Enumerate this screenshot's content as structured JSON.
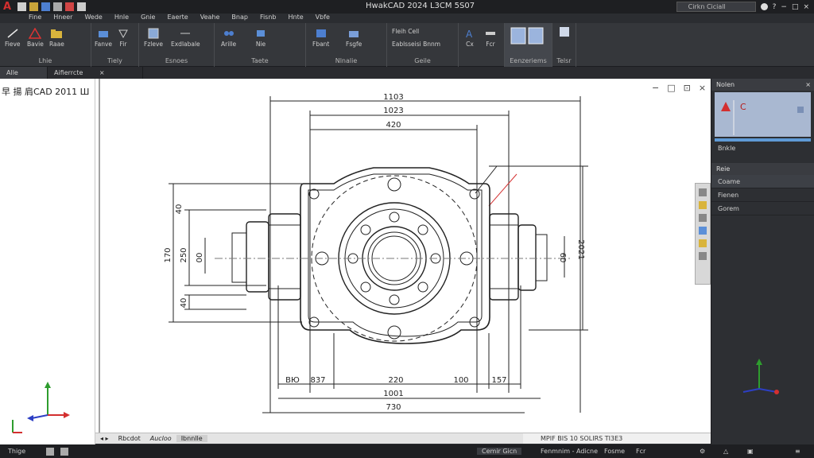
{
  "app": {
    "window_title": "HwakCAD 2024 L3CM 5S07",
    "logo": "A",
    "search_placeholder": "Cirkn Ciciall"
  },
  "menu": [
    "Fine",
    "Hneer",
    "Wede",
    "Hnle",
    "Gnie",
    "Eaerte",
    "Veahe",
    "Bnap",
    "Fisnb",
    "Hnte",
    "Vbfe"
  ],
  "ribbon": {
    "groups": [
      {
        "label": "Lhie",
        "buttons": [
          "Fieve",
          "Bavie",
          "Raae"
        ]
      },
      {
        "label": "Tiely",
        "buttons": [
          "Fanve",
          "Fir"
        ]
      },
      {
        "label": "Esnoes",
        "buttons": [
          "Fzleve",
          "Exdlabale"
        ]
      },
      {
        "label": "Taete",
        "buttons": [
          "Arille",
          "Nie"
        ]
      },
      {
        "label": "Nlnalie",
        "buttons": [
          "Fbant",
          "Fsgfe"
        ]
      },
      {
        "label": "Geile",
        "buttons": [
          "Fleih Cell",
          "Eablsseisi Bnnm"
        ]
      },
      {
        "label": "",
        "buttons": [
          "Cx",
          "Fcr"
        ]
      },
      {
        "label": "Eenzeriems",
        "buttons": [
          ""
        ]
      },
      {
        "label": "Telsr",
        "buttons": [
          ""
        ]
      }
    ]
  },
  "tabs": {
    "items": [
      "Alle",
      "Aifierrcte"
    ],
    "close": "×"
  },
  "viewport": {
    "title": "早 揚 肩CAD 2011 Ш"
  },
  "drawing": {
    "dims_top": [
      "1103",
      "1023",
      "420"
    ],
    "dims_bottom": [
      "837",
      "220",
      "100",
      "157",
      "1001",
      "730"
    ],
    "dim_bottom_left": "BЮ",
    "dims_left": [
      "40",
      "170",
      "250",
      "00",
      "40"
    ],
    "dim_right": "2021",
    "dim_right_inner": "60"
  },
  "layout_tabs": [
    "Rbcdot",
    "Aucloo",
    "Ibnnlle"
  ],
  "commandline": {
    "text": "MPIF BIS 10 SOLIRS TI3E3"
  },
  "right_panel": {
    "header": "Nolen",
    "preview_letter": "C",
    "row1": "Bnkle",
    "section": "Reie",
    "items": [
      {
        "label": "Coame",
        "selected": true
      },
      {
        "label": "Fienen",
        "selected": false
      },
      {
        "label": "Gorem",
        "selected": false
      }
    ]
  },
  "statusbar": {
    "left": "Thige",
    "model": "Cemir Gicn",
    "mode": "Fenmnim - Adicne",
    "scale_label": "Fosme",
    "scale_value": "Fcr"
  },
  "colors": {
    "accent_red": "#d32f2f",
    "ribbon_bg": "#35373b",
    "canvas_bg": "#ffffff",
    "ucs_y": "#2e9d2e",
    "ucs_x": "#d32f2f",
    "ucs_z": "#2d3fc4"
  },
  "icons": [
    "save-icon",
    "undo-icon",
    "redo-icon",
    "search-icon",
    "close-icon",
    "minimize-icon",
    "maximize-icon",
    "line-icon",
    "circle-icon",
    "dimension-icon",
    "layer-icon",
    "gear-icon"
  ]
}
